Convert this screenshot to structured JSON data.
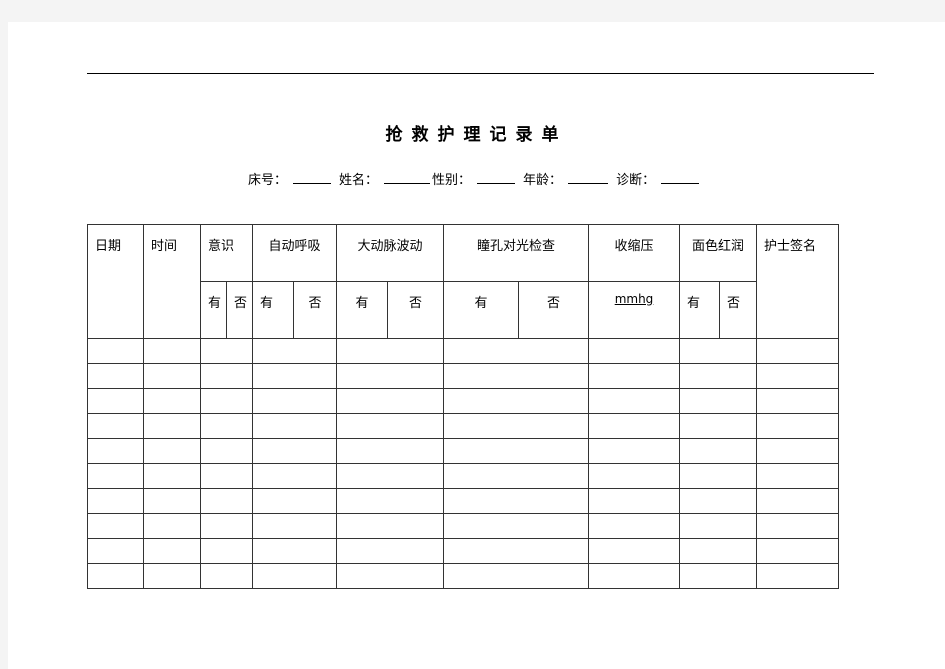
{
  "document": {
    "title": "抢救护理记录单",
    "patient_info": {
      "bed_no_label": "床号：",
      "name_label": "姓名：",
      "sex_label": "性别：",
      "age_label": "年龄：",
      "diagnosis_label": "诊断："
    },
    "table": {
      "headers": {
        "date": "日期",
        "time": "时间",
        "consciousness": "意识",
        "spontaneous_breathing": "自动呼吸",
        "aortic_pulse": "大动脉波动",
        "pupil_light_reflex": "瞳孔对光检查",
        "systolic_pressure": "收缩压",
        "face_flush": "面色红润",
        "nurse_signature": "护士签名"
      },
      "sub_headers": {
        "yes": "有",
        "no": "否",
        "unit": "mmhg"
      },
      "rows": [
        [
          "",
          "",
          "",
          "",
          "",
          "",
          "",
          "",
          "",
          "",
          "",
          "",
          "",
          ""
        ],
        [
          "",
          "",
          "",
          "",
          "",
          "",
          "",
          "",
          "",
          "",
          "",
          "",
          "",
          ""
        ],
        [
          "",
          "",
          "",
          "",
          "",
          "",
          "",
          "",
          "",
          "",
          "",
          "",
          "",
          ""
        ],
        [
          "",
          "",
          "",
          "",
          "",
          "",
          "",
          "",
          "",
          "",
          "",
          "",
          "",
          ""
        ],
        [
          "",
          "",
          "",
          "",
          "",
          "",
          "",
          "",
          "",
          "",
          "",
          "",
          "",
          ""
        ],
        [
          "",
          "",
          "",
          "",
          "",
          "",
          "",
          "",
          "",
          "",
          "",
          "",
          "",
          ""
        ],
        [
          "",
          "",
          "",
          "",
          "",
          "",
          "",
          "",
          "",
          "",
          "",
          "",
          "",
          ""
        ],
        [
          "",
          "",
          "",
          "",
          "",
          "",
          "",
          "",
          "",
          "",
          "",
          "",
          "",
          ""
        ],
        [
          "",
          "",
          "",
          "",
          "",
          "",
          "",
          "",
          "",
          "",
          "",
          "",
          "",
          ""
        ],
        [
          "",
          "",
          "",
          "",
          "",
          "",
          "",
          "",
          "",
          "",
          "",
          "",
          "",
          ""
        ]
      ]
    }
  }
}
